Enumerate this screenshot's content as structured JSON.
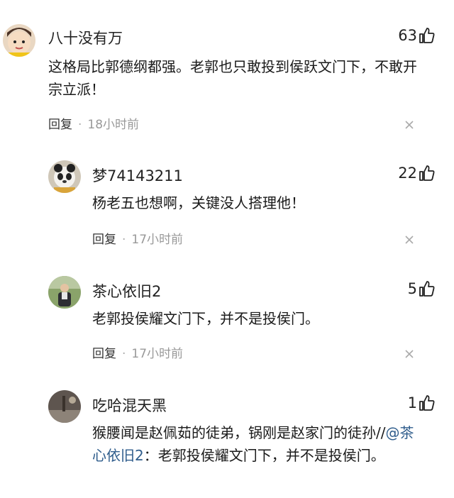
{
  "comments": [
    {
      "username": "八十没有万",
      "likes": "63",
      "text": "这格局比郭德纲都强。老郭也只敢投到侯跃文门下，不敢开宗立派！",
      "reply_label": "回复",
      "time": "18小时前"
    },
    {
      "username": "梦74143211",
      "likes": "22",
      "text": "杨老五也想啊，关键没人搭理他！",
      "reply_label": "回复",
      "time": "17小时前"
    },
    {
      "username": "茶心依旧2",
      "likes": "5",
      "text": "老郭投侯耀文门下，并不是投侯门。",
      "reply_label": "回复",
      "time": "17小时前"
    },
    {
      "username": "吃哈混天黑",
      "likes": "1",
      "text_main": "猴腰闻是赵佩茹的徒弟，锅刚是赵家门的徒孙//",
      "mention": "@茶心依旧2",
      "text_quote": "：老郭投侯耀文门下，并不是投侯门。"
    }
  ],
  "icons": {
    "like": "thumbs-up-icon",
    "close": "close-icon"
  },
  "colors": {
    "mention": "#2f5d8c",
    "meta": "#999999"
  }
}
